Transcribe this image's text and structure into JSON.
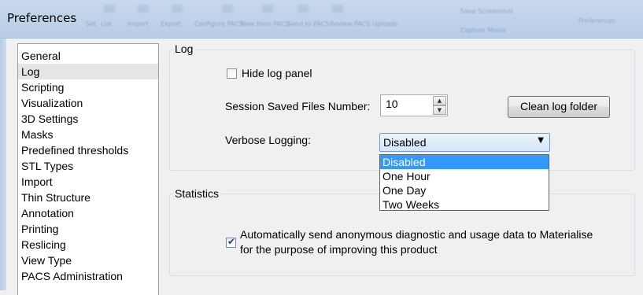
{
  "window": {
    "title": "Preferences",
    "background_toolbar_labels": [
      "Set",
      "List",
      "Import",
      "Export",
      "Configure PACS",
      "New from PACS",
      "Send to PACS",
      "Review PACS Uploads",
      "Save Screenshot",
      "Preferences",
      "Capture Movie"
    ]
  },
  "sidebar": {
    "items": [
      {
        "label": "General"
      },
      {
        "label": "Log",
        "selected": true
      },
      {
        "label": "Scripting"
      },
      {
        "label": "Visualization"
      },
      {
        "label": "3D Settings"
      },
      {
        "label": "Masks"
      },
      {
        "label": "Predefined thresholds"
      },
      {
        "label": "STL Types"
      },
      {
        "label": "Import"
      },
      {
        "label": "Thin Structure"
      },
      {
        "label": "Annotation"
      },
      {
        "label": "Printing"
      },
      {
        "label": "Reslicing"
      },
      {
        "label": "View Type"
      },
      {
        "label": "PACS Administration"
      }
    ]
  },
  "log_group": {
    "title": "Log",
    "hide_log_panel": {
      "label": "Hide log panel",
      "checked": false
    },
    "session_saved_files": {
      "label": "Session Saved Files Number:",
      "value": "10"
    },
    "clean_button_label": "Clean log folder",
    "verbose_logging": {
      "label": "Verbose Logging:",
      "selected": "Disabled",
      "options": [
        "Disabled",
        "One Hour",
        "One Day",
        "Two Weeks"
      ],
      "highlighted_option": "Disabled",
      "open": true
    }
  },
  "statistics_group": {
    "title": "Statistics",
    "auto_send": {
      "line1": "Automatically send anonymous diagnostic and usage data to Materialise",
      "line2": "for the purpose of improving this product",
      "checked": true
    }
  },
  "colors": {
    "titlebar": "#c7d8ec",
    "highlight": "#3399ff",
    "selected_item": "#e5e5e5"
  }
}
